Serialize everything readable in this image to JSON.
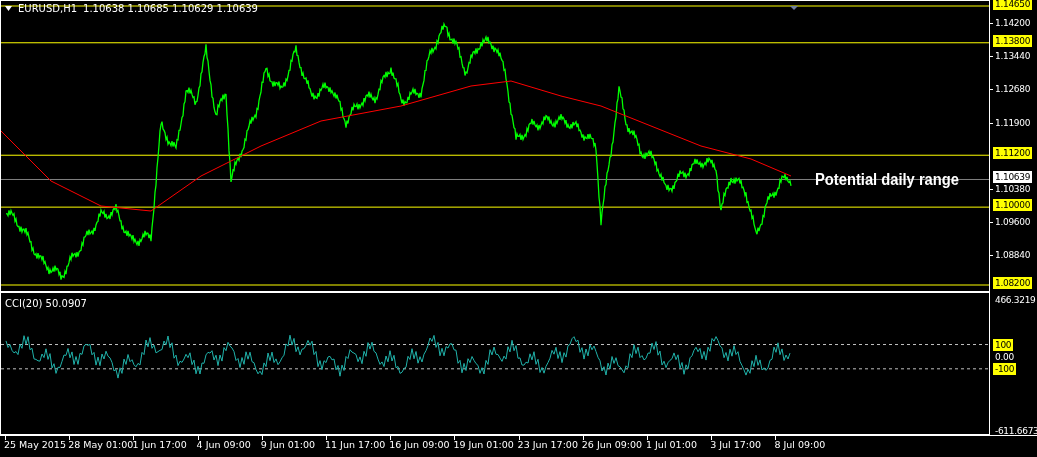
{
  "price_chart": {
    "symbol": "EURUSD,H1",
    "quotes": "1.10638 1.10685 1.10629 1.10639",
    "annotation": "Potential daily range",
    "price_axis": [
      {
        "label": "1.14650",
        "kind": "level"
      },
      {
        "label": "1.14200",
        "kind": "tick"
      },
      {
        "label": "1.13800",
        "kind": "level"
      },
      {
        "label": "1.13440",
        "kind": "tick"
      },
      {
        "label": "1.12680",
        "kind": "tick"
      },
      {
        "label": "1.11900",
        "kind": "tick"
      },
      {
        "label": "1.11200",
        "kind": "level"
      },
      {
        "label": "1.10639",
        "kind": "current"
      },
      {
        "label": "1.10380",
        "kind": "tick"
      },
      {
        "label": "1.10000",
        "kind": "level"
      },
      {
        "label": "1.09600",
        "kind": "tick"
      },
      {
        "label": "1.08840",
        "kind": "tick"
      },
      {
        "label": "1.08200",
        "kind": "level"
      }
    ]
  },
  "indicator": {
    "title": "CCI(20) 50.0907",
    "axis": [
      {
        "label": "466.3219",
        "kind": "bound"
      },
      {
        "label": "100",
        "kind": "level"
      },
      {
        "label": "0.00",
        "kind": "tick"
      },
      {
        "label": "-100",
        "kind": "level"
      },
      {
        "label": "-611.6673",
        "kind": "bound"
      }
    ]
  },
  "time_axis": [
    "25 May 2015",
    "28 May 01:00",
    "1 Jun 17:00",
    "4 Jun 09:00",
    "9 Jun 01:00",
    "11 Jun 17:00",
    "16 Jun 09:00",
    "19 Jun 01:00",
    "23 Jun 17:00",
    "26 Jun 09:00",
    "1 Jul 01:00",
    "3 Jul 17:00",
    "8 Jul 09:00"
  ]
}
